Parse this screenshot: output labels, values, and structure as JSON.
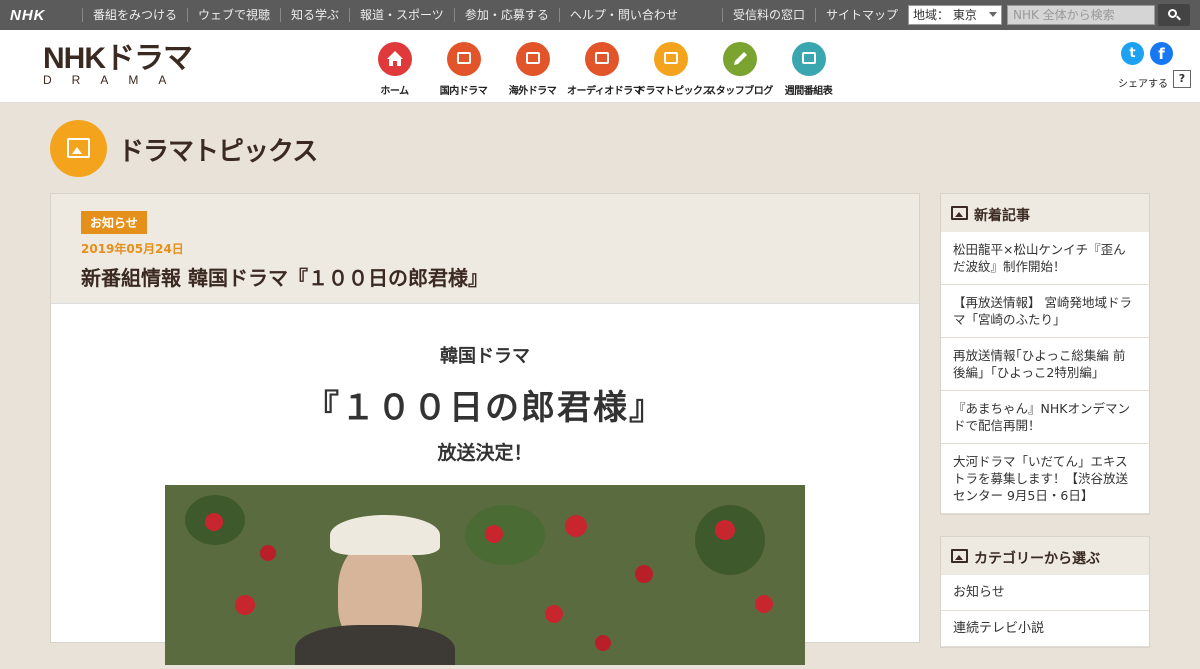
{
  "topbar": {
    "logo": "NHK",
    "links": [
      "番組をみつける",
      "ウェブで視聴",
      "知る学ぶ",
      "報道・スポーツ",
      "参加・応募する",
      "ヘルプ・問い合わせ"
    ],
    "right_links": [
      "受信料の窓口",
      "サイトマップ"
    ],
    "region": "地域： 東京",
    "search_placeholder": "NHK 全体から検索"
  },
  "header": {
    "logo_main": "NHKドラマ",
    "logo_sub": "DRAMA",
    "nav": [
      {
        "label": "ホーム",
        "icon": "home-icon",
        "color": "#e0393b"
      },
      {
        "label": "国内ドラマ",
        "icon": "tv-icon",
        "color": "#e2542a"
      },
      {
        "label": "海外ドラマ",
        "icon": "tv-icon",
        "color": "#e2542a"
      },
      {
        "label": "オーディオドラマ",
        "icon": "radio-icon",
        "color": "#e2542a"
      },
      {
        "label": "ドラマトピックス",
        "icon": "picture-icon",
        "color": "#f4a41c"
      },
      {
        "label": "スタッフブログ",
        "icon": "pencil-icon",
        "color": "#7aa32f"
      },
      {
        "label": "週間番組表",
        "icon": "calendar-icon",
        "color": "#3aa6b0"
      }
    ],
    "share_label": "シェアする",
    "help": "?"
  },
  "section": {
    "title": "ドラマトピックス"
  },
  "article": {
    "badge": "お知らせ",
    "date": "2019年05月24日",
    "title": "新番組情報 韓国ドラマ『１００日の郎君様』",
    "kicker": "韓国ドラマ",
    "show_name": "『１００日の郎君様』",
    "decided": "放送決定！"
  },
  "sidebar": {
    "news_title": "新着記事",
    "news": [
      "松田龍平×松山ケンイチ『歪んだ波紋』制作開始！",
      "【再放送情報】 宮崎発地域ドラマ「宮崎のふたり」",
      "再放送情報｢ひよっこ総集編 前後編｣「ひよっこ2特別編」",
      "『あまちゃん』NHKオンデマンドで配信再開！",
      "大河ドラマ「いだてん」エキストラを募集します！【渋谷放送センター 9月5日・6日】"
    ],
    "category_title": "カテゴリーから選ぶ",
    "categories": [
      "お知らせ",
      "連続テレビ小説"
    ]
  }
}
